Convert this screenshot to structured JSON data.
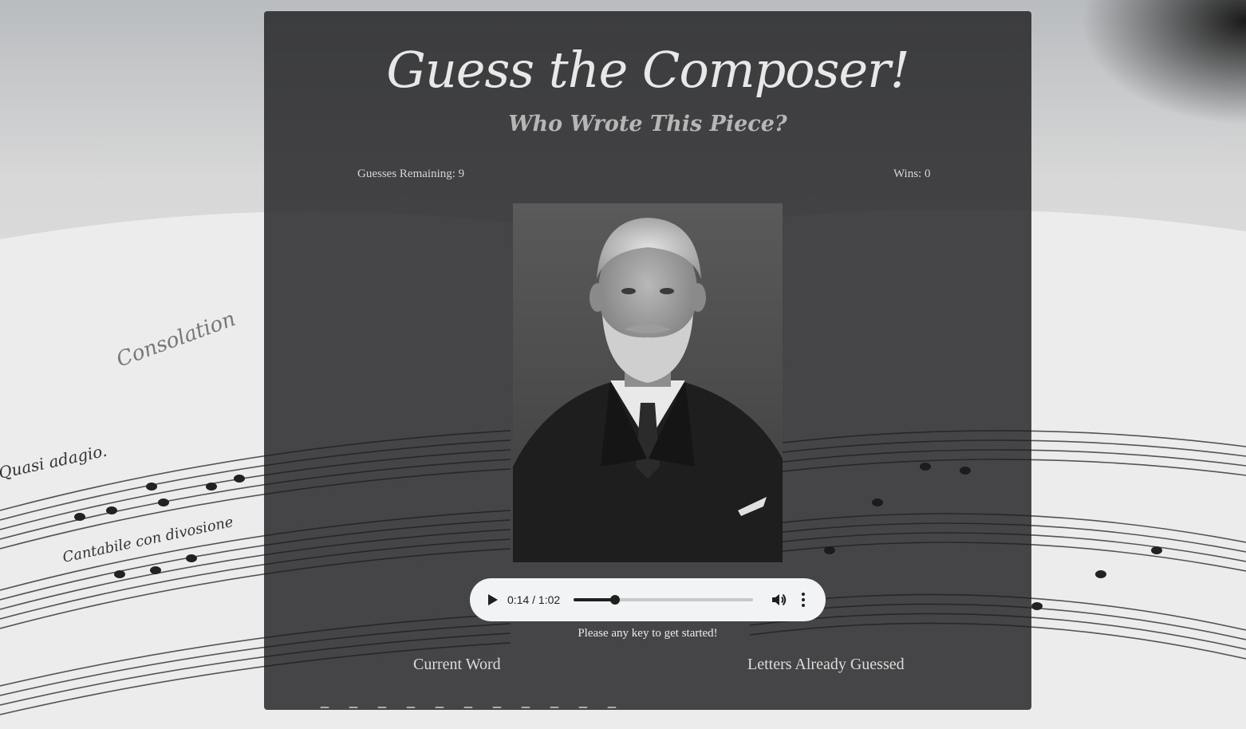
{
  "header": {
    "title": "Guess the Composer!",
    "subtitle": "Who Wrote This Piece?"
  },
  "stats": {
    "guesses_remaining": "Guesses Remaining: 9",
    "wins": "Wins: 0"
  },
  "portrait": {
    "icon": "composer-portrait-photo"
  },
  "audio_player": {
    "time": "0:14 / 1:02",
    "progress": 0.23,
    "play_icon": "play-icon",
    "volume_icon": "volume-icon",
    "more_icon": "more-vertical-icon"
  },
  "prompt": "Please any key to get started!",
  "labels": {
    "current_word": "Current Word",
    "letters_guessed": "Letters Already Guessed"
  },
  "word_blanks": [
    "_",
    "_",
    "_",
    "_",
    "_",
    "_",
    "_",
    "_",
    "_",
    "_",
    "_"
  ],
  "colors": {
    "panel": "#1c1c1e",
    "player": "#f1f3f4",
    "text": "#e6e6e6"
  }
}
